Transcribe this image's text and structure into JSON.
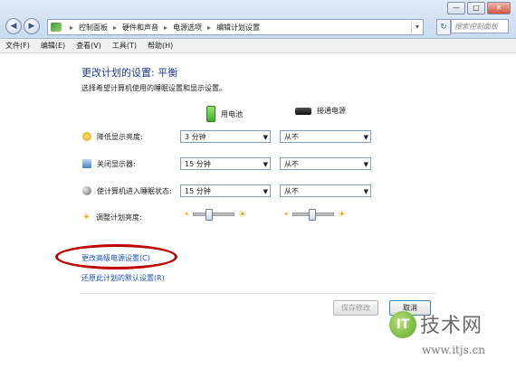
{
  "window": {
    "minimize": "—",
    "maximize": "□",
    "close": "✕"
  },
  "nav": {
    "back": "◀",
    "forward": "▶"
  },
  "address": {
    "crumbs": [
      "控制面板",
      "硬件和声音",
      "电源选项",
      "编辑计划设置"
    ],
    "separator": "▸",
    "dropdown": "▾",
    "refresh": "↻"
  },
  "search": {
    "placeholder": "搜索控制面板"
  },
  "menu": [
    "文件(F)",
    "编辑(E)",
    "查看(V)",
    "工具(T)",
    "帮助(H)"
  ],
  "page": {
    "title": "更改计划的设置: 平衡",
    "description": "选择希望计算机使用的睡眠设置和显示设置。",
    "col_battery": "用电池",
    "col_plugged": "接通电源"
  },
  "settings": [
    {
      "label": "降低显示亮度:",
      "battery": "3 分钟",
      "plugged": "从不",
      "icon": "dim-icon"
    },
    {
      "label": "关闭显示器:",
      "battery": "15 分钟",
      "plugged": "从不",
      "icon": "monitor-icon"
    },
    {
      "label": "使计算机进入睡眠状态:",
      "battery": "15 分钟",
      "plugged": "从不",
      "icon": "sleep-icon"
    }
  ],
  "brightness": {
    "label": "调整计划亮度:",
    "battery_level": 0.35,
    "plugged_level": 0.45
  },
  "links": {
    "advanced": "更改高级电源设置(C)",
    "restore": "还原此计划的默认设置(R)"
  },
  "buttons": {
    "save": "保存修改",
    "cancel": "取消"
  },
  "watermark": {
    "logo": "IT",
    "brand": "技术网",
    "url": "www.itjs.cn"
  },
  "colors": {
    "highlight_oval": "#c00000",
    "link": "#1a4fb4",
    "heading": "#1e3a8a"
  }
}
